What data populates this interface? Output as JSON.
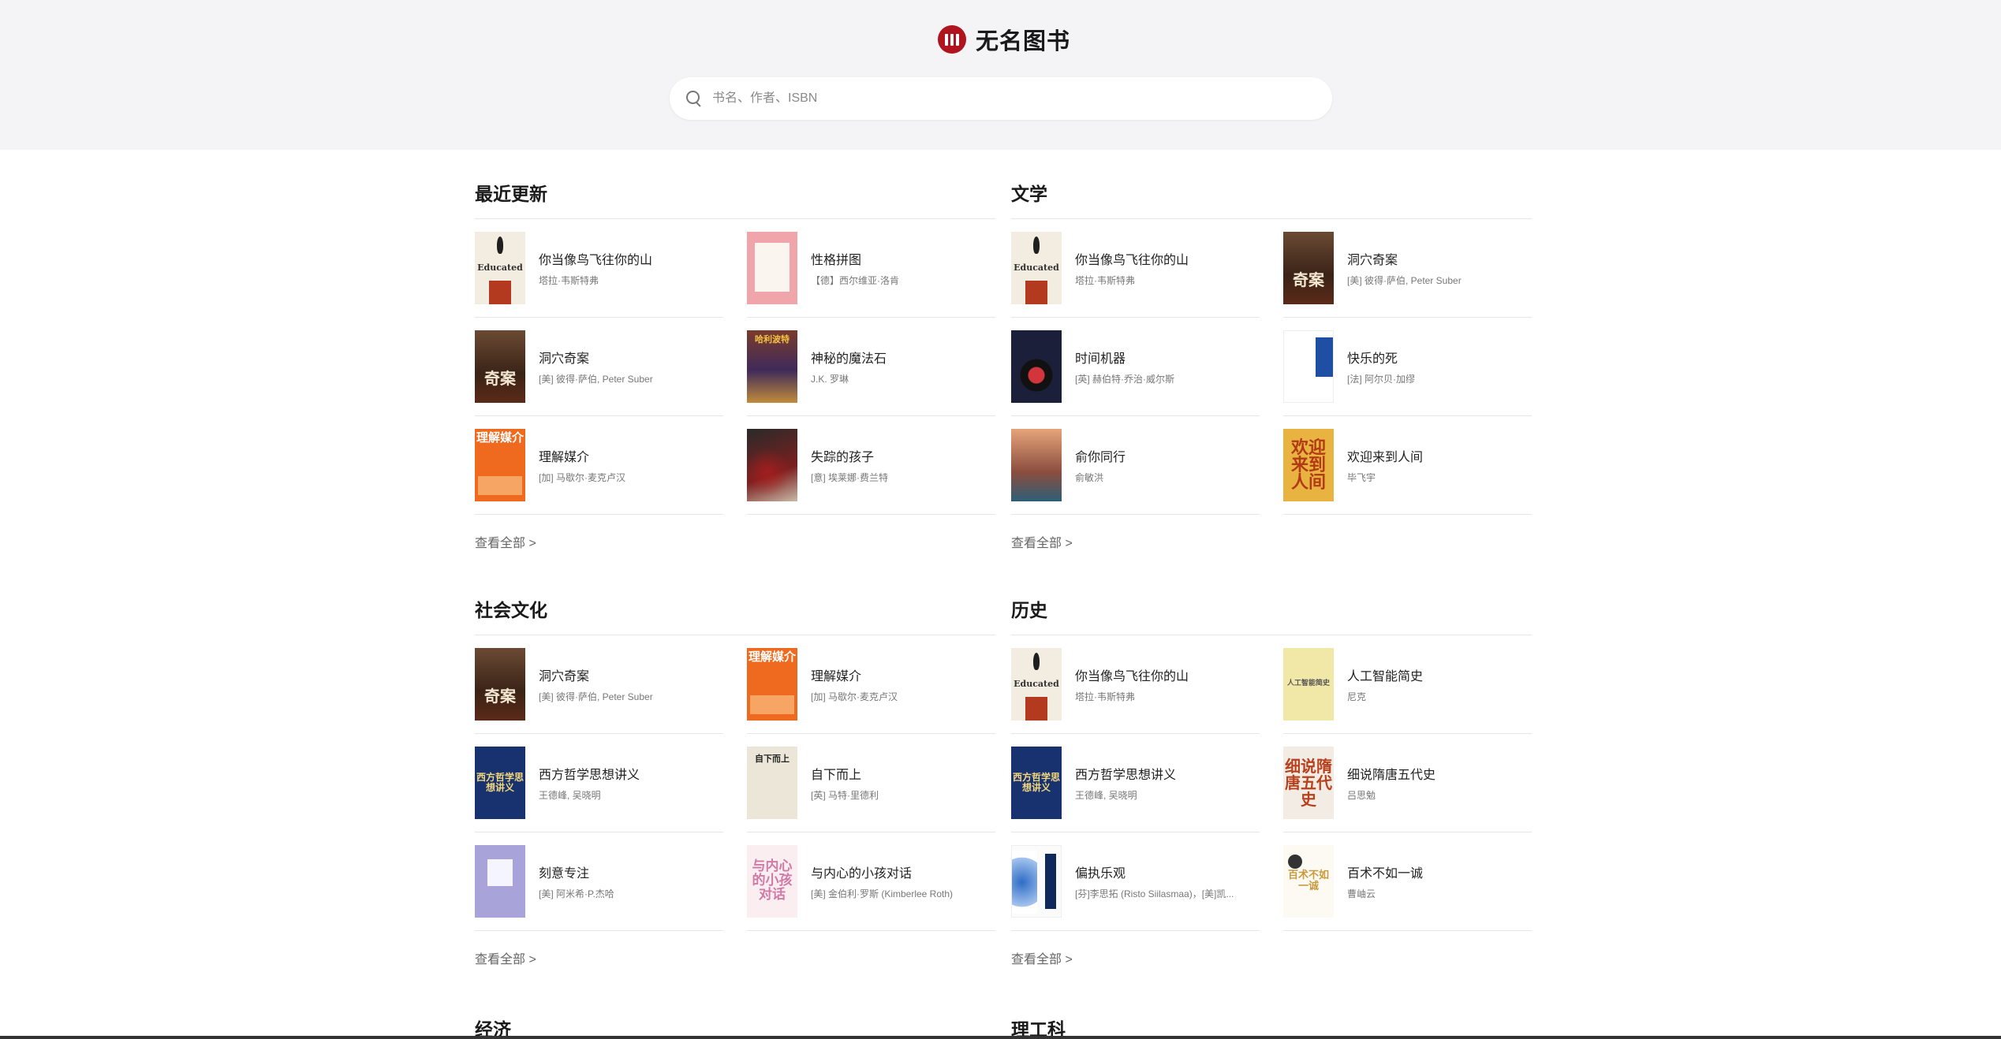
{
  "app": {
    "name": "无名图书",
    "search_placeholder": "书名、作者、ISBN"
  },
  "sections": [
    {
      "title": "最近更新",
      "view_all": "查看全部 >",
      "books": [
        {
          "title": "你当像鸟飞往你的山",
          "author": "塔拉·韦斯特弗",
          "cover_text": "Educated"
        },
        {
          "title": "性格拼图",
          "author": "【德】西尔维亚·洛肯",
          "cover_text": ""
        },
        {
          "title": "洞穴奇案",
          "author": "[美] 彼得·萨伯, Peter Suber",
          "cover_text": "奇案"
        },
        {
          "title": "神秘的魔法石",
          "author": "J.K. 罗琳",
          "cover_text": "哈利波特"
        },
        {
          "title": "理解媒介",
          "author": "[加] 马歇尔·麦克卢汉",
          "cover_text": "理解媒介"
        },
        {
          "title": "失踪的孩子",
          "author": "[意] 埃莱娜·费兰特",
          "cover_text": ""
        }
      ]
    },
    {
      "title": "文学",
      "view_all": "查看全部 >",
      "books": [
        {
          "title": "你当像鸟飞往你的山",
          "author": "塔拉·韦斯特弗",
          "cover_text": "Educated"
        },
        {
          "title": "洞穴奇案",
          "author": "[美] 彼得·萨伯, Peter Suber",
          "cover_text": "奇案"
        },
        {
          "title": "时间机器",
          "author": "[英] 赫伯特·乔治·威尔斯",
          "cover_text": ""
        },
        {
          "title": "快乐的死",
          "author": "[法] 阿尔贝·加缪",
          "cover_text": ""
        },
        {
          "title": "俞你同行",
          "author": "俞敏洪",
          "cover_text": ""
        },
        {
          "title": "欢迎来到人间",
          "author": "毕飞宇",
          "cover_text": "欢迎来到人间"
        }
      ]
    },
    {
      "title": "社会文化",
      "view_all": "查看全部 >",
      "books": [
        {
          "title": "洞穴奇案",
          "author": "[美] 彼得·萨伯, Peter Suber",
          "cover_text": "奇案"
        },
        {
          "title": "理解媒介",
          "author": "[加] 马歇尔·麦克卢汉",
          "cover_text": "理解媒介"
        },
        {
          "title": "西方哲学思想讲义",
          "author": "王德峰, 吴晓明",
          "cover_text": "西方哲学思想讲义"
        },
        {
          "title": "自下而上",
          "author": "[英] 马特·里德利",
          "cover_text": "自下而上"
        },
        {
          "title": "刻意专注",
          "author": "[美] 阿米希·P.杰哈",
          "cover_text": ""
        },
        {
          "title": "与内心的小孩对话",
          "author": "[美] 金伯利·罗斯 (Kimberlee Roth)",
          "cover_text": "与内心的小孩对话"
        }
      ]
    },
    {
      "title": "历史",
      "view_all": "查看全部 >",
      "books": [
        {
          "title": "你当像鸟飞往你的山",
          "author": "塔拉·韦斯特弗",
          "cover_text": "Educated"
        },
        {
          "title": "人工智能简史",
          "author": "尼克",
          "cover_text": "人工智能简史"
        },
        {
          "title": "西方哲学思想讲义",
          "author": "王德峰, 吴晓明",
          "cover_text": "西方哲学思想讲义"
        },
        {
          "title": "细说隋唐五代史",
          "author": "吕思勉",
          "cover_text": "细说隋唐五代史"
        },
        {
          "title": "偏执乐观",
          "author": "[芬]李思拓 (Risto Siilasmaa)，[美]凯...",
          "cover_text": ""
        },
        {
          "title": "百术不如一诚",
          "author": "曹岫云",
          "cover_text": "百术不如一诚"
        }
      ]
    }
  ],
  "next_sections": [
    "经济",
    "理工科"
  ],
  "colors": {
    "brand": "#b0141e",
    "header_bg": "#f4f4f6"
  }
}
